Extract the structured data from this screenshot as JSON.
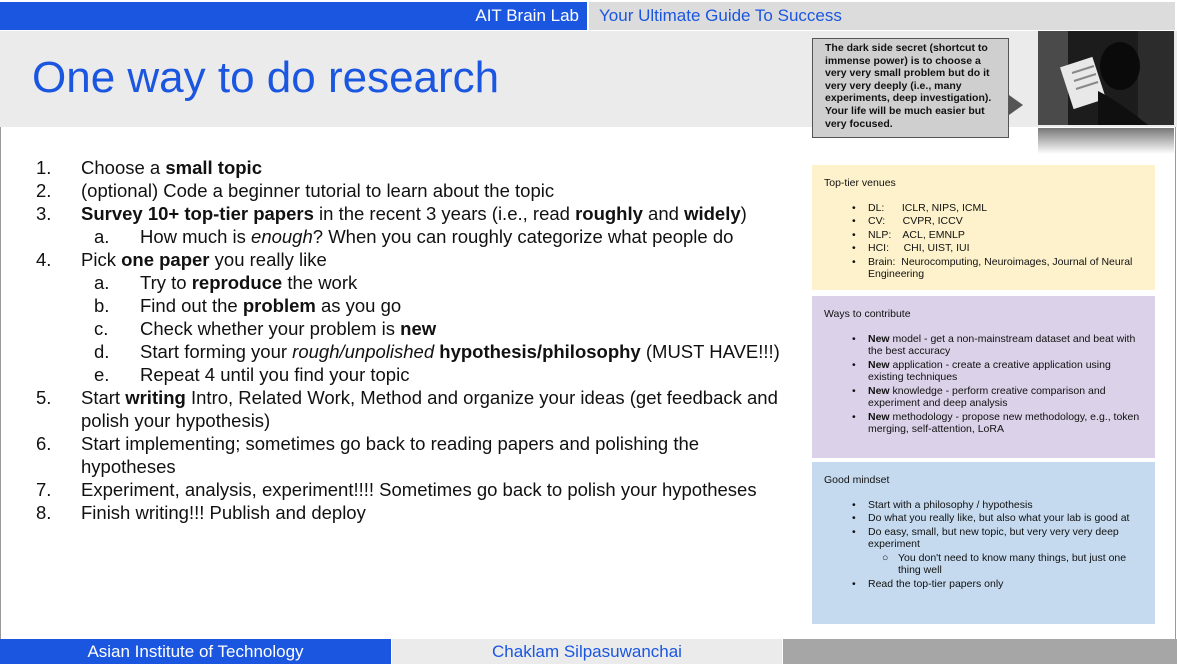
{
  "header": {
    "lab": "AIT Brain Lab",
    "tagline": "Your Ultimate Guide To Success"
  },
  "title": "One way to do research",
  "steps": [
    {
      "num": "1.",
      "parts": [
        {
          "t": "Choose a "
        },
        {
          "t": "small topic",
          "b": true
        }
      ]
    },
    {
      "num": "2.",
      "parts": [
        {
          "t": "(optional) Code a beginner tutorial to learn about the topic"
        }
      ]
    },
    {
      "num": "3.",
      "parts": [
        {
          "t": "Survey 10+ top-tier papers",
          "b": true
        },
        {
          "t": " in the recent 3 years (i.e., read "
        },
        {
          "t": "roughly",
          "b": true
        },
        {
          "t": " and "
        },
        {
          "t": "widely",
          "b": true
        },
        {
          "t": ")"
        }
      ],
      "subs": [
        {
          "letter": "a.",
          "parts": [
            {
              "t": "How much is "
            },
            {
              "t": "enough",
              "i": true
            },
            {
              "t": "?  When you can roughly categorize what people do"
            }
          ]
        }
      ]
    },
    {
      "num": "4.",
      "parts": [
        {
          "t": "Pick "
        },
        {
          "t": "one paper",
          "b": true
        },
        {
          "t": " you really like"
        }
      ],
      "subs": [
        {
          "letter": "a.",
          "parts": [
            {
              "t": "Try to "
            },
            {
              "t": "reproduce",
              "b": true
            },
            {
              "t": " the work"
            }
          ]
        },
        {
          "letter": "b.",
          "parts": [
            {
              "t": "Find out the "
            },
            {
              "t": "problem",
              "b": true
            },
            {
              "t": " as you go"
            }
          ]
        },
        {
          "letter": "c.",
          "parts": [
            {
              "t": "Check whether your problem is "
            },
            {
              "t": "new",
              "b": true
            }
          ]
        },
        {
          "letter": "d.",
          "parts": [
            {
              "t": "Start forming your "
            },
            {
              "t": "rough/unpolished",
              "i": true
            },
            {
              "t": " "
            },
            {
              "t": "hypothesis/philosophy",
              "b": true
            },
            {
              "t": " (MUST HAVE!!!)"
            }
          ]
        },
        {
          "letter": "e.",
          "parts": [
            {
              "t": "Repeat 4 until you find your topic"
            }
          ]
        }
      ]
    },
    {
      "num": "5.",
      "parts": [
        {
          "t": "Start "
        },
        {
          "t": "writing",
          "b": true
        },
        {
          "t": " Intro, Related Work, Method and organize your ideas  (get feedback and polish your hypothesis)"
        }
      ]
    },
    {
      "num": "6.",
      "parts": [
        {
          "t": "Start implementing; sometimes go back to reading papers and polishing the hypotheses"
        }
      ]
    },
    {
      "num": "7.",
      "parts": [
        {
          "t": "Experiment, analysis, experiment!!!! Sometimes go back to polish your hypotheses"
        }
      ]
    },
    {
      "num": "8.",
      "parts": [
        {
          "t": "Finish writing!!!  Publish and deploy"
        }
      ]
    }
  ],
  "callout": "The dark side secret (shortcut to immense power) is to choose a very very small problem but do it very very deeply (i.e., many experiments, deep investigation). Your life will be much easier but very focused.",
  "venues": {
    "title": "Top-tier venues",
    "items": [
      "DL:      ICLR, NIPS, ICML",
      "CV:      CVPR, ICCV",
      "NLP:    ACL, EMNLP",
      "HCI:     CHI, UIST, IUI",
      "Brain:  Neurocomputing, Neuroimages, Journal of Neural Engineering"
    ]
  },
  "ways": {
    "title": "Ways to contribute",
    "items": [
      {
        "bold": "New",
        "rest": " model - get a non-mainstream dataset and beat with the best accuracy"
      },
      {
        "bold": "New",
        "rest": " application - create a creative application using existing techniques"
      },
      {
        "bold": "New",
        "rest": " knowledge - perform creative comparison and experiment and deep analysis"
      },
      {
        "bold": "New",
        "rest": " methodology - propose new methodology, e.g., token merging, self-attention, LoRA"
      }
    ]
  },
  "mindset": {
    "title": "Good mindset",
    "items": [
      {
        "text": "Start with a philosophy / hypothesis",
        "level": 1
      },
      {
        "text": "Do what you really like, but also what your lab is good at",
        "level": 1
      },
      {
        "text": "Do easy, small, but new topic, but very very very deep experiment",
        "level": 1
      },
      {
        "text": "You don't need to know many things, but just one thing well",
        "level": 2
      },
      {
        "text": "Read the top-tier papers only",
        "level": 1
      }
    ]
  },
  "footer": {
    "institute": "Asian Institute of Technology",
    "author": "Chaklam Silpasuwanchai"
  },
  "colors": {
    "accent": "#1a56e0",
    "venues_bg": "#fdf2cb",
    "ways_bg": "#dbd1e8",
    "mindset_bg": "#c5daef"
  },
  "icons": {
    "bullet": "•",
    "sub_bullet": "○"
  }
}
